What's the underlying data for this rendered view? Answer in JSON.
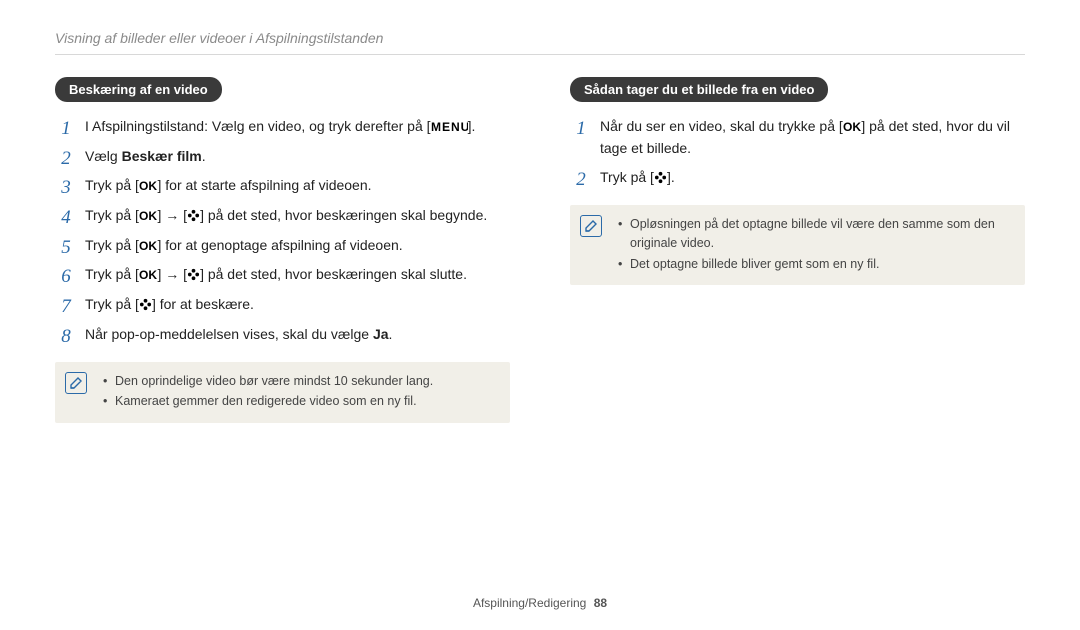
{
  "header": "Visning af billeder eller videoer i Afspilningstilstanden",
  "left": {
    "pill": "Beskæring af en video",
    "steps": {
      "s1a": "I Afspilningstilstand: Vælg en video, og tryk derefter på [",
      "s1b": "].",
      "s2a": "Vælg ",
      "s2b": "Beskær film",
      "s2c": ".",
      "s3a": "Tryk på [",
      "s3b": "] for at starte afspilning af videoen.",
      "s4a": "Tryk på [",
      "s4b": "] → [",
      "s4c": "] på det sted, hvor beskæringen skal begynde.",
      "s5a": "Tryk på [",
      "s5b": "] for at genoptage afspilning af videoen.",
      "s6a": "Tryk på [",
      "s6b": "] → [",
      "s6c": "] på det sted, hvor beskæringen skal slutte.",
      "s7a": "Tryk på [",
      "s7b": "] for at beskære.",
      "s8a": "Når pop-op-meddelelsen vises, skal du vælge ",
      "s8b": "Ja",
      "s8c": "."
    },
    "note": {
      "n1": "Den oprindelige video bør være mindst 10 sekunder lang.",
      "n2": "Kameraet gemmer den redigerede video som en ny fil."
    }
  },
  "right": {
    "pill": "Sådan tager du et billede fra en video",
    "steps": {
      "s1a": "Når du ser en video, skal du trykke på [",
      "s1b": "] på det sted, hvor du vil tage et billede.",
      "s2a": "Tryk på [",
      "s2b": "]."
    },
    "note": {
      "n1": "Opløsningen på det optagne billede vil være den samme som den originale video.",
      "n2": "Det optagne billede bliver gemt som en ny fil."
    }
  },
  "footer": {
    "section": "Afspilning/Redigering",
    "page": "88"
  },
  "icons": {
    "menu": "menu-icon",
    "ok": "ok-icon",
    "flower": "flower-icon",
    "note": "pencil-note-icon"
  }
}
